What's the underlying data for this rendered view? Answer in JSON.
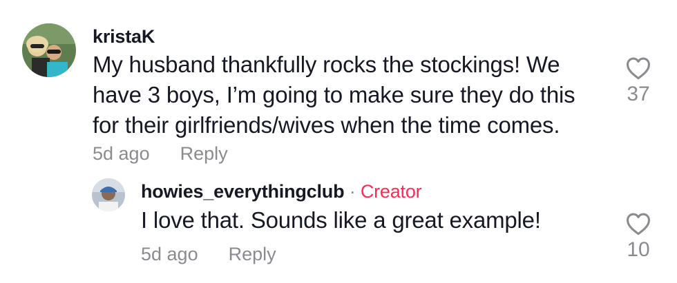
{
  "comments": [
    {
      "username": "kristaK",
      "text_lines": [
        "My husband thankfully rocks the stockings! We",
        "have 3 boys, I’m going to make sure they do this",
        "for their girlfriends/wives when the time comes."
      ],
      "time": "5d ago",
      "reply_label": "Reply",
      "likes": "37",
      "like_icon": "heart-outline-icon"
    },
    {
      "username": "howies_everythingclub",
      "separator": "·",
      "badge": "Creator",
      "text_lines": [
        "I love that. Sounds like a great example!"
      ],
      "time": "5d ago",
      "reply_label": "Reply",
      "likes": "10",
      "like_icon": "heart-outline-icon"
    }
  ],
  "colors": {
    "text": "#161823",
    "muted": "#8a8b91",
    "creator_badge": "#fe2c55",
    "background": "#ffffff"
  }
}
